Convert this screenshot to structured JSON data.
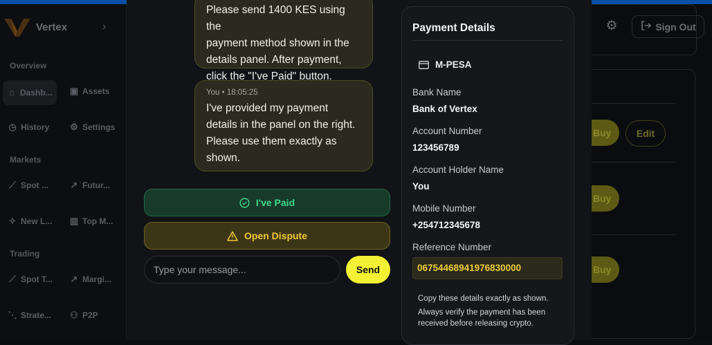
{
  "app": {
    "name": "Vertex"
  },
  "sidebar": {
    "sections": [
      {
        "title": "Overview",
        "items": [
          {
            "label": "Dashb...",
            "icon": "home-icon"
          },
          {
            "label": "Assets",
            "icon": "wallet-icon"
          },
          {
            "label": "History",
            "icon": "history-icon"
          },
          {
            "label": "Settings",
            "icon": "gear-icon"
          }
        ]
      },
      {
        "title": "Markets",
        "items": [
          {
            "label": "Spot ...",
            "icon": "chart-line-icon"
          },
          {
            "label": "Futur...",
            "icon": "trend-icon"
          },
          {
            "label": "New L...",
            "icon": "sparkles-icon"
          },
          {
            "label": "Top M...",
            "icon": "bar-chart-icon"
          }
        ]
      },
      {
        "title": "Trading",
        "items": [
          {
            "label": "Spot T...",
            "icon": "chart-line-icon"
          },
          {
            "label": "Margi...",
            "icon": "trend-icon"
          },
          {
            "label": "Strate...",
            "icon": "strategy-icon"
          },
          {
            "label": "P2P",
            "icon": "users-icon"
          }
        ]
      }
    ]
  },
  "header": {
    "sign_out": "Sign Out"
  },
  "offers": {
    "buy": "Buy",
    "edit": "Edit"
  },
  "chat": {
    "messages": [
      {
        "meta": "",
        "lines": [
          "Please send 1400 KES using the",
          "payment method shown in the",
          "details panel. After payment,",
          "click the \"I've Paid\" button."
        ]
      },
      {
        "meta": "You • 18:05:25",
        "lines": [
          "I've provided my payment",
          "details in the panel on the right.",
          "Please use them exactly as",
          "shown."
        ]
      }
    ],
    "paid_label": "I've Paid",
    "dispute_label": "Open Dispute",
    "input_placeholder": "Type your message...",
    "send_label": "Send"
  },
  "payment": {
    "title": "Payment Details",
    "method": "M-PESA",
    "fields": [
      {
        "label": "Bank Name",
        "value": "Bank of Vertex"
      },
      {
        "label": "Account Number",
        "value": "123456789"
      },
      {
        "label": "Account Holder Name",
        "value": "You"
      },
      {
        "label": "Mobile Number",
        "value": "+254712345678"
      },
      {
        "label": "Reference Number",
        "value": "06754468941976830000"
      }
    ],
    "note_lines": [
      "Copy these details exactly as shown.",
      "Always verify the payment has been",
      "received before releasing crypto."
    ]
  },
  "colors": {
    "accent": "#f3f133",
    "paid": "#3ed98a",
    "dispute": "#f0c93a"
  }
}
